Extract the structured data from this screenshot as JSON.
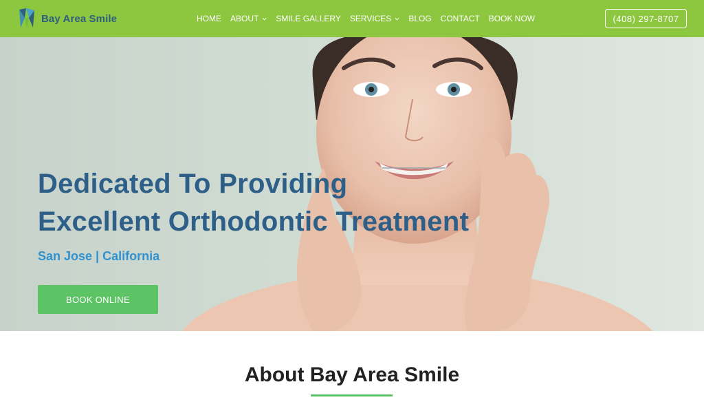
{
  "header": {
    "logo_text": "Bay Area Smile",
    "nav": [
      {
        "label": "HOME",
        "has_dropdown": false
      },
      {
        "label": "ABOUT",
        "has_dropdown": true
      },
      {
        "label": "SMILE GALLERY",
        "has_dropdown": false
      },
      {
        "label": "SERVICES",
        "has_dropdown": true
      },
      {
        "label": "BLOG",
        "has_dropdown": false
      },
      {
        "label": "CONTACT",
        "has_dropdown": false
      },
      {
        "label": "BOOK NOW",
        "has_dropdown": false
      }
    ],
    "phone": "(408) 297-8707"
  },
  "hero": {
    "title_line1": "Dedicated To Providing",
    "title_line2": "Excellent Orthodontic Treatment",
    "subtitle": "San Jose | California",
    "cta_label": "BOOK ONLINE"
  },
  "about": {
    "title": "About Bay Area Smile"
  },
  "colors": {
    "header_bg": "#8dc63f",
    "title_blue": "#2e5f88",
    "subtitle_blue": "#2f92d0",
    "cta_green": "#5dc466"
  }
}
